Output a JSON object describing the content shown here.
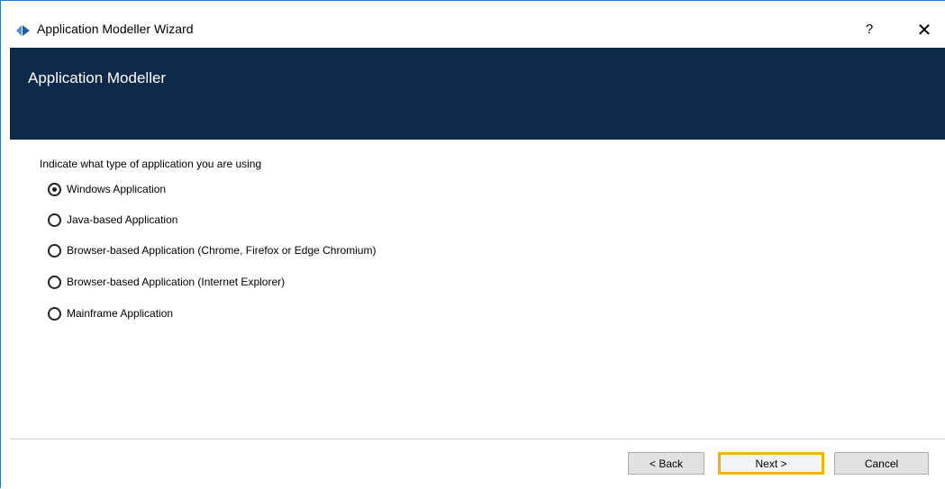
{
  "window": {
    "title": "Application Modeller Wizard",
    "help_label": "?",
    "close_label": "✕"
  },
  "header": {
    "title": "Application Modeller"
  },
  "main": {
    "prompt": "Indicate what type of application you are using",
    "options": [
      {
        "label": "Windows Application",
        "checked": true
      },
      {
        "label": "Java-based Application",
        "checked": false
      },
      {
        "label": "Browser-based Application (Chrome, Firefox or Edge Chromium)",
        "checked": false
      },
      {
        "label": "Browser-based Application (Internet Explorer)",
        "checked": false
      },
      {
        "label": "Mainframe Application",
        "checked": false
      }
    ]
  },
  "footer": {
    "back_label": "< Back",
    "next_label": "Next >",
    "cancel_label": "Cancel"
  },
  "colors": {
    "header_bg": "#0e2a4a",
    "focus_border": "#f0b400",
    "window_border": "#1a7ad4"
  },
  "icons": {
    "app": "app-modeller-icon",
    "close": "close-icon",
    "help": "help-icon"
  }
}
